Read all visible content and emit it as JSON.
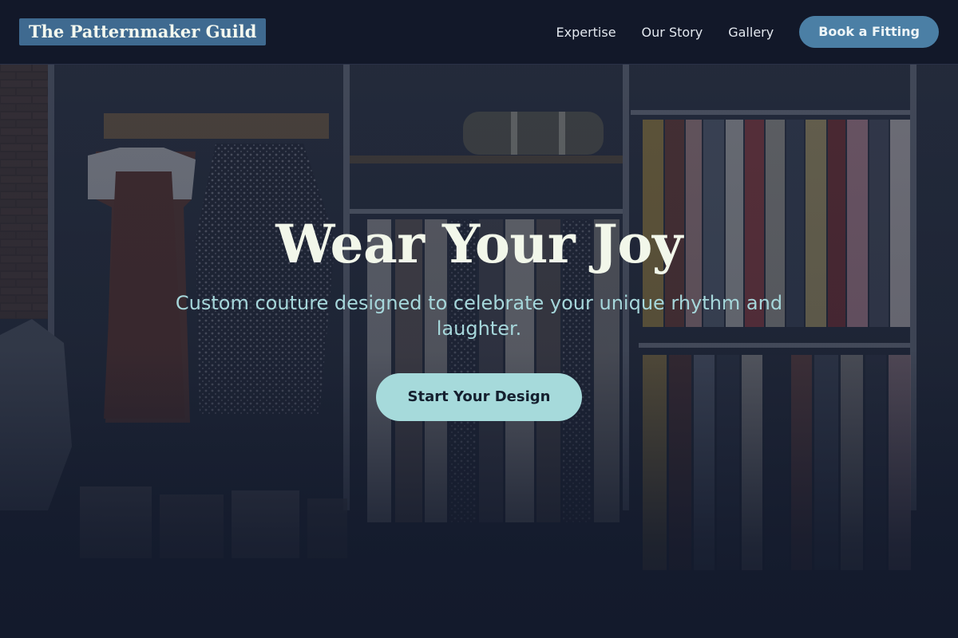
{
  "brand": {
    "logo_text": "The Patternmaker Guild"
  },
  "nav": {
    "links": [
      {
        "label": "Expertise"
      },
      {
        "label": "Our Story"
      },
      {
        "label": "Gallery"
      }
    ],
    "cta_label": "Book a Fitting"
  },
  "hero": {
    "title": "Wear Your Joy",
    "subtitle": "Custom couture designed to celebrate your unique rhythm and laughter.",
    "cta_label": "Start Your Design",
    "background_image": "clothing-boutique-racks"
  },
  "colors": {
    "page_background": "#131a2c",
    "logo_background": "#3f6a90",
    "nav_cta_background": "#4b7fa5",
    "hero_title": "#f2f7ea",
    "hero_subtitle": "#a6d7db",
    "hero_cta_background": "#a6dadb"
  }
}
